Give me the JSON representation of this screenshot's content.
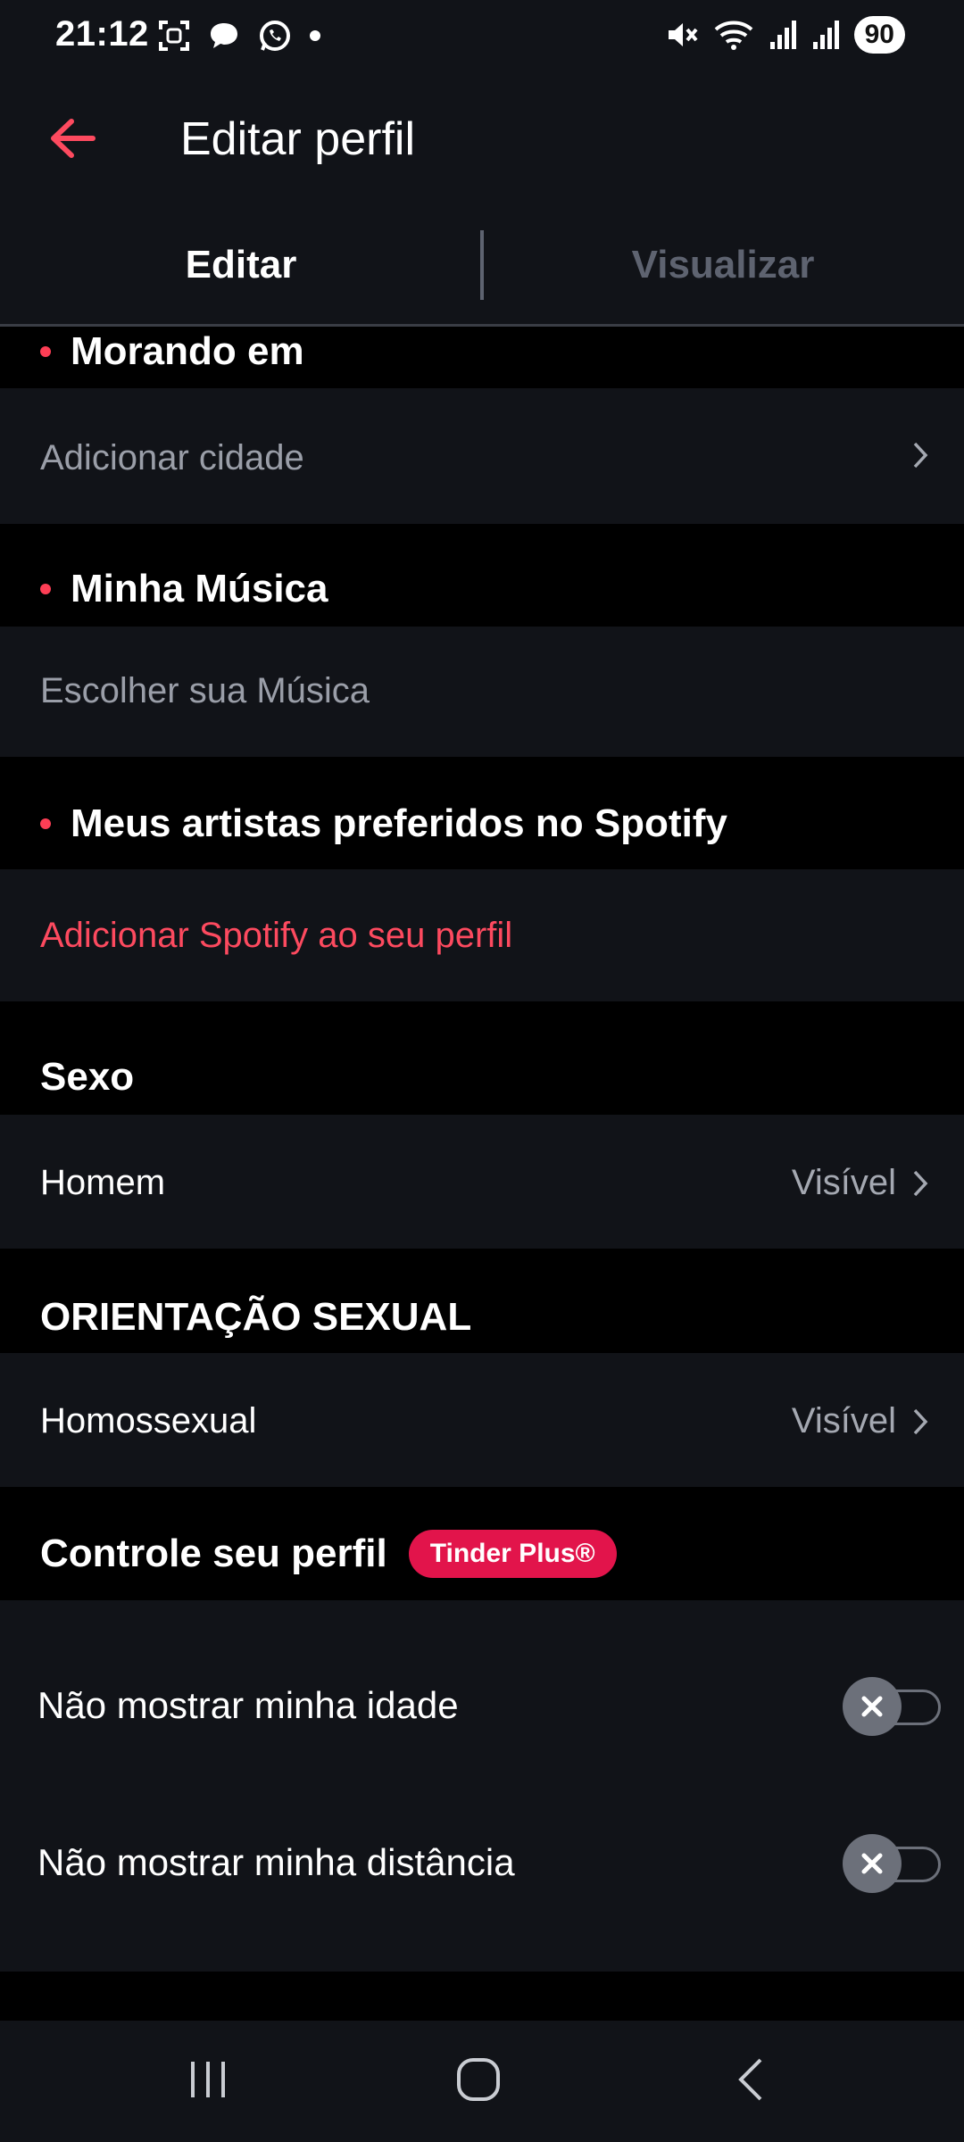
{
  "status_bar": {
    "time": "21:12",
    "battery": "90",
    "left_icons": [
      "screenshot-icon",
      "chat-bubble-icon",
      "whatsapp-icon",
      "dot-icon"
    ],
    "right_icons": [
      "mute-icon",
      "wifi-icon",
      "signal-icon",
      "signal-icon"
    ]
  },
  "header": {
    "title": "Editar perfil",
    "back_icon": "arrow-left-icon"
  },
  "tabs": [
    {
      "label": "Editar",
      "active": true
    },
    {
      "label": "Visualizar",
      "active": false
    }
  ],
  "sections": {
    "living_in": {
      "title": "Morando em",
      "row_text": "Adicionar cidade"
    },
    "my_music": {
      "title": "Minha Música",
      "row_text": "Escolher sua Música"
    },
    "spotify_artists": {
      "title": "Meus artistas preferidos no Spotify",
      "row_text": "Adicionar Spotify ao seu perfil"
    },
    "gender": {
      "title": "Sexo",
      "value": "Homem",
      "visibility": "Visível"
    },
    "orientation": {
      "title": "ORIENTAÇÃO SEXUAL",
      "value": "Homossexual",
      "visibility": "Visível"
    },
    "control": {
      "title": "Controle seu perfil",
      "badge": "Tinder Plus®",
      "options": [
        {
          "label": "Não mostrar minha idade",
          "enabled": false
        },
        {
          "label": "Não mostrar minha distância",
          "enabled": false
        }
      ]
    }
  },
  "colors": {
    "accent": "#fd4a5f",
    "badge": "#e2144b",
    "background": "#000000",
    "surface": "#111318"
  }
}
